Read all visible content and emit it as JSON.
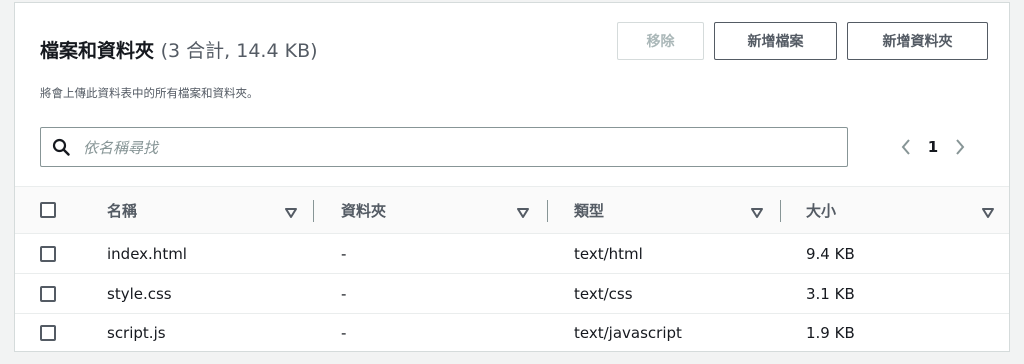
{
  "header": {
    "title": "檔案和資料夾",
    "count": "(3 合計, 14.4 KB)",
    "description": "將會上傳此資料表中的所有檔案和資料夾。"
  },
  "actions": {
    "remove_label": "移除",
    "add_files_label": "新增檔案",
    "add_folder_label": "新增資料夾"
  },
  "search": {
    "placeholder": "依名稱尋找",
    "value": "",
    "icon": "search-icon"
  },
  "pagination": {
    "current_page": "1",
    "prev_icon": "chevron-left-icon",
    "next_icon": "chevron-right-icon"
  },
  "table": {
    "columns": [
      {
        "label": "名稱"
      },
      {
        "label": "資料夾"
      },
      {
        "label": "類型"
      },
      {
        "label": "大小"
      }
    ],
    "rows": [
      {
        "name": "index.html",
        "folder": "-",
        "type": "text/html",
        "size": "9.4 KB"
      },
      {
        "name": "style.css",
        "folder": "-",
        "type": "text/css",
        "size": "3.1 KB"
      },
      {
        "name": "script.js",
        "folder": "-",
        "type": "text/javascript",
        "size": "1.9 KB"
      }
    ]
  },
  "colors": {
    "text_primary": "#16191f",
    "text_secondary": "#545b64",
    "disabled": "#aab7b8",
    "border": "#d5dbdb"
  }
}
